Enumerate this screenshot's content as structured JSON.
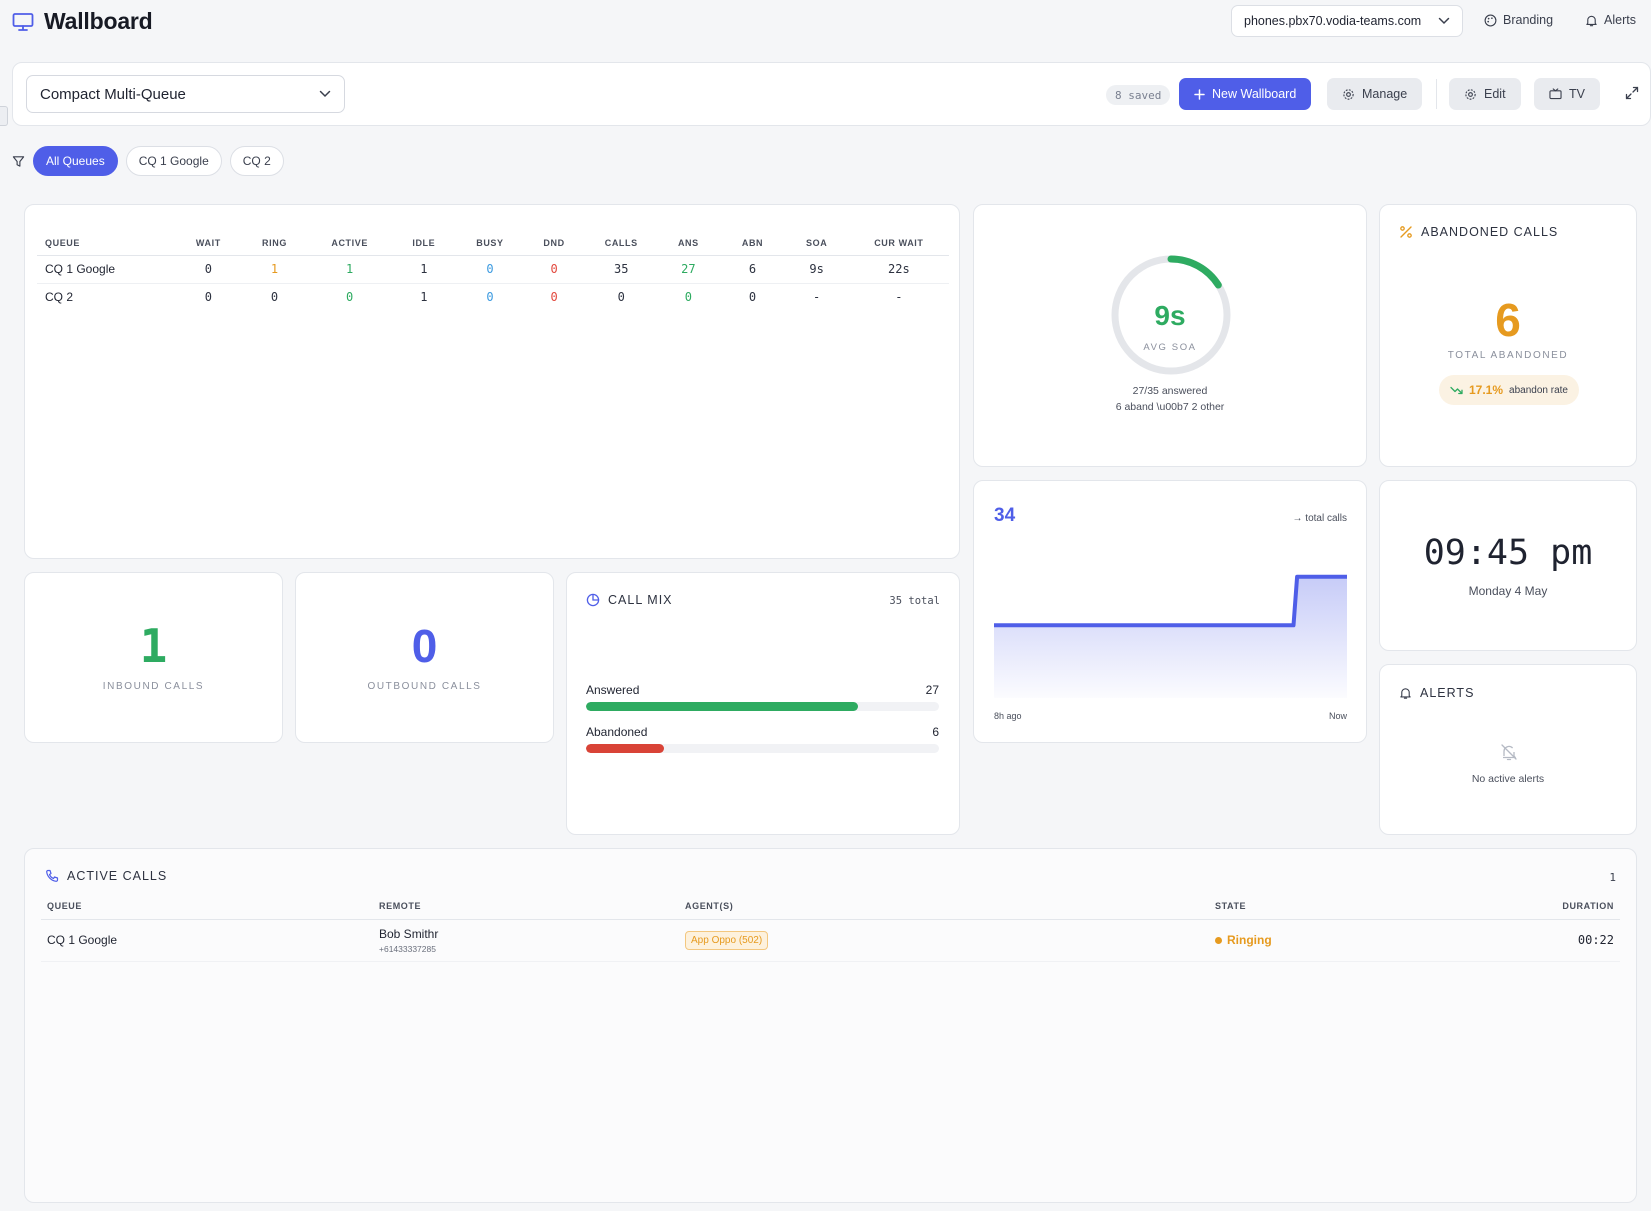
{
  "app": {
    "title": "Wallboard"
  },
  "topbar": {
    "domain": "phones.pbx70.vodia-teams.com",
    "branding_label": "Branding",
    "alerts_label": "Alerts"
  },
  "header": {
    "wallboard_name": "Compact Multi-Queue",
    "saved_badge": "8 saved",
    "new_wallboard_label": "New Wallboard",
    "manage_label": "Manage",
    "edit_label": "Edit",
    "tv_label": "TV"
  },
  "filters": {
    "chips": [
      "All Queues",
      "CQ 1 Google",
      "CQ 2"
    ],
    "active": "All Queues"
  },
  "queue_table": {
    "columns": [
      "QUEUE",
      "WAIT",
      "RING",
      "ACTIVE",
      "IDLE",
      "BUSY",
      "DND",
      "CALLS",
      "ANS",
      "ABN",
      "SOA",
      "CUR WAIT"
    ],
    "rows": [
      [
        "CQ 1 Google",
        "0",
        "1",
        "1",
        "1",
        "0",
        "0",
        "35",
        "27",
        "6",
        "9s",
        "22s"
      ],
      [
        "CQ 2",
        "0",
        "0",
        "0",
        "1",
        "0",
        "0",
        "0",
        "0",
        "0",
        "-",
        "-"
      ]
    ]
  },
  "soa": {
    "value": "9s",
    "label": "AVG SOA",
    "answered_text": "27/35 answered",
    "sub_text": "6 aband \\u00b7 2 other",
    "gauge_fraction": 0.16
  },
  "abandoned": {
    "title": "ABANDONED CALLS",
    "value": "6",
    "label": "TOTAL ABANDONED",
    "rate": "17.1%",
    "rate_label": "abandon rate"
  },
  "inbound": {
    "value": "1",
    "label": "INBOUND CALLS"
  },
  "outbound": {
    "value": "0",
    "label": "OUTBOUND CALLS"
  },
  "call_mix": {
    "title": "CALL MIX",
    "total_text": "35 total",
    "items": [
      {
        "label": "Answered",
        "value": "27",
        "fraction": 0.771,
        "color": "#2eab61"
      },
      {
        "label": "Abandoned",
        "value": "6",
        "fraction": 0.22,
        "color": "#d94337"
      }
    ]
  },
  "trend": {
    "value": "34",
    "legend": "→ total calls",
    "x_start": "8h ago",
    "x_end": "Now"
  },
  "chart_data": {
    "type": "area",
    "title": "",
    "xlabel": "",
    "ylabel": "",
    "x_labels": [
      "8h ago",
      "Now"
    ],
    "series": [
      {
        "values": [
          33,
          33,
          33,
          33,
          33,
          33,
          33,
          33,
          33,
          33,
          33,
          33,
          33,
          33,
          33,
          33,
          33,
          33,
          33,
          33,
          33,
          33,
          33,
          33,
          33,
          33,
          33,
          33,
          33,
          33,
          33,
          33,
          33,
          33,
          33,
          33,
          33,
          33,
          33,
          33,
          33,
          33,
          33,
          33,
          33,
          33,
          33,
          33,
          33,
          33,
          33,
          33,
          33,
          33,
          33,
          33,
          33,
          33,
          33,
          33,
          33,
          33,
          33,
          33,
          33,
          33,
          33,
          33,
          33,
          33,
          33,
          33,
          33,
          33,
          33,
          33,
          33,
          33,
          33,
          33,
          33,
          33,
          33,
          33,
          33,
          34,
          34,
          34,
          34,
          34,
          34,
          34,
          34,
          34,
          34,
          34,
          34,
          34,
          34,
          34
        ]
      }
    ],
    "ylim": [
      0,
      34.8
    ],
    "grid": false,
    "legend": "top-right"
  },
  "clock": {
    "time": "09:45 pm",
    "date": "Monday 4 May"
  },
  "alerts_card": {
    "title": "ALERTS",
    "empty_text": "No active alerts"
  },
  "active_calls": {
    "title": "ACTIVE CALLS",
    "count": "1",
    "columns": [
      "QUEUE",
      "REMOTE",
      "AGENT(S)",
      "STATE",
      "DURATION"
    ],
    "rows": [
      {
        "queue": "CQ 1 Google",
        "remote_name": "Bob Smithr",
        "remote_number": "+61433337285",
        "agent": "App Oppo (502)",
        "state": "Ringing",
        "duration": "00:22"
      }
    ]
  },
  "colors": {
    "accent": "#4f5ee8",
    "green": "#2eab61",
    "orange": "#e69a1f",
    "red": "#d94337"
  }
}
